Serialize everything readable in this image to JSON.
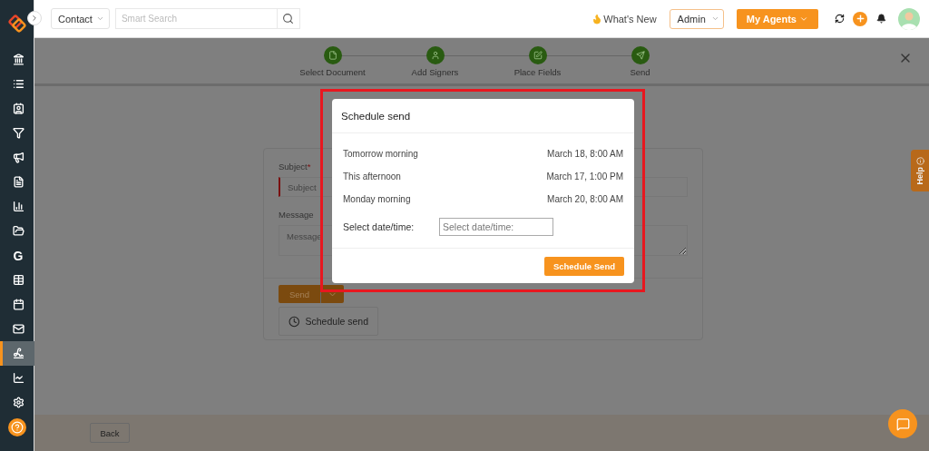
{
  "sidebar": {
    "items": [
      {
        "selected": false
      },
      {
        "selected": false
      },
      {
        "selected": false
      },
      {
        "selected": false
      },
      {
        "selected": false
      },
      {
        "selected": false
      },
      {
        "selected": false
      },
      {
        "selected": false
      },
      {
        "selected": false,
        "text": "G"
      },
      {
        "selected": false
      },
      {
        "selected": false
      },
      {
        "selected": false
      },
      {
        "selected": true
      },
      {
        "selected": false
      },
      {
        "selected": false
      }
    ]
  },
  "topbar": {
    "module_select": "Contact",
    "search": {
      "placeholder": "Smart Search"
    },
    "whats_new": "What's New",
    "role_select": "Admin",
    "agents_button": "My Agents"
  },
  "stepper": {
    "steps": [
      {
        "label": "Select Document"
      },
      {
        "label": "Add Signers"
      },
      {
        "label": "Place Fields"
      },
      {
        "label": "Send"
      }
    ]
  },
  "form": {
    "subject_label": "Subject",
    "required_mark": "*",
    "subject": {
      "placeholder": "Subject"
    },
    "message_label": "Message",
    "message": {
      "placeholder": "Message"
    },
    "send_button": "Send",
    "schedule_button": "Schedule send"
  },
  "footer": {
    "back_button": "Back"
  },
  "help_tab": "Help",
  "modal": {
    "title": "Schedule send",
    "options": [
      {
        "label": "Tomorrow morning",
        "time": "March 18, 8:00 AM"
      },
      {
        "label": "This afternoon",
        "time": "March 17, 1:00 PM"
      },
      {
        "label": "Monday morning",
        "time": "March 20, 8:00 AM"
      }
    ],
    "custom_label": "Select date/time:",
    "custom": {
      "placeholder": "Select date/time:"
    },
    "submit_button": "Schedule Send"
  }
}
